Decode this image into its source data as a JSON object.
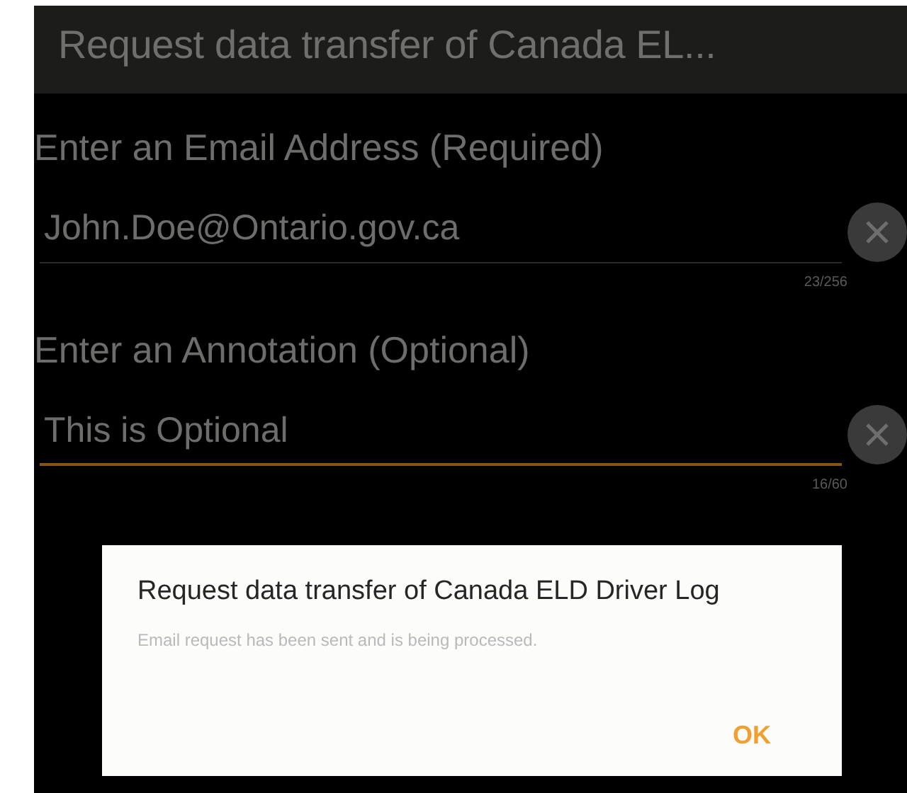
{
  "title_bar": {
    "title": "Request data transfer of Canada EL..."
  },
  "fields": [
    {
      "label": "Enter an Email Address (Required)",
      "value": "John.Doe@Ontario.gov.ca",
      "counter": "23/256",
      "focused": false
    },
    {
      "label": "Enter an Annotation (Optional)",
      "value": "This is Optional",
      "counter": "16/60",
      "focused": true
    }
  ],
  "dialog": {
    "title": "Request data transfer of Canada ELD Driver Log",
    "message": "Email request has been sent and is being processed.",
    "buttons": [
      "OK"
    ]
  }
}
